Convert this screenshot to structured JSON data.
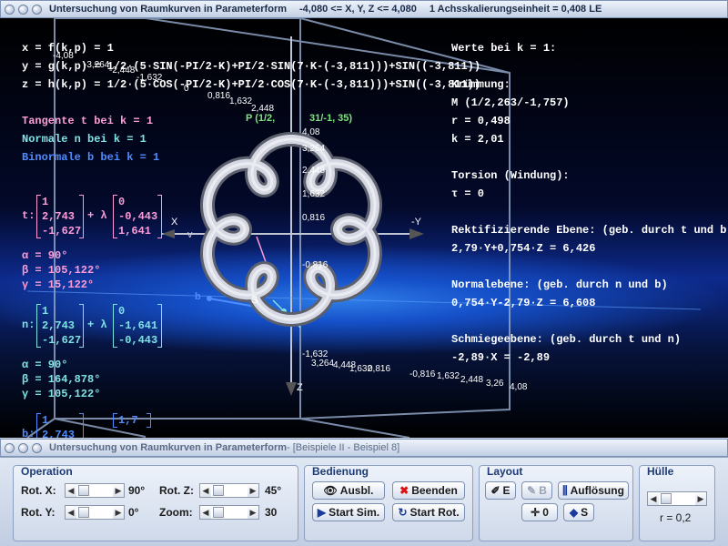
{
  "window": {
    "title": "Untersuchung von Raumkurven in Parameterform",
    "range": "-4,080 <= X, Y, Z <= 4,080",
    "unit": "1 Achsskalierungseinheit = 0,408 LE"
  },
  "window2": {
    "title": "Untersuchung von Raumkurven in Parameterform",
    "subtitle": " - [Beispiele II - Beispiel 8]"
  },
  "formulas": {
    "x": "x = f(k,p) = 1",
    "y": "y = g(k,p) = 1/2·(5·SIN(-PI/2-K)+PI/2·SIN(7·K-(-3,811)))+SIN((-3,811))",
    "z": "z = h(k,p) = 1/2·(5·COS(-PI/2-K)+PI/2·COS(7·K-(-3,811)))+SIN((-3,811))"
  },
  "legend": {
    "tangent": "Tangente t bei k = 1",
    "normal": "Normale n bei k = 1",
    "binormal": "Binormale b bei k = 1"
  },
  "vectors": {
    "t_label": "t:",
    "n_label": "n:",
    "b_label": "b:",
    "plus_lambda": "+ λ",
    "t_point": [
      "1",
      "2,743",
      "-1,627"
    ],
    "t_dir": [
      "0",
      "-0,443",
      "1,641"
    ],
    "t_angles": [
      "α = 90°",
      "β = 105,122°",
      "γ = 15,122°"
    ],
    "n_point": [
      "1",
      "2,743",
      "-1,627"
    ],
    "n_dir": [
      "0",
      "-1,641",
      "-0,443"
    ],
    "n_angles": [
      "α = 90°",
      "β = 164,878°",
      "γ = 105,122°"
    ],
    "b_point": [
      "1",
      "2,743"
    ],
    "b_dir": [
      "1,7"
    ]
  },
  "values": {
    "header": "Werte bei k = 1:",
    "curvature_label": "Krümmung:",
    "m": "M (1/2,263/-1,757)",
    "r": "r = 0,498",
    "k": "k = 2,01",
    "torsion_label": "Torsion (Windung):",
    "tau": "τ = 0",
    "rect_label": "Rektifizierende Ebene: (geb. durch t und b)",
    "rect_eq": "2,79·Y+0,754·Z = 6,426",
    "normal_label": "Normalebene: (geb. durch n und b)",
    "normal_eq": "0,754·Y-2,79·Z = 6,608",
    "osc_label": "Schmiegeebene: (geb. durch t und n)",
    "osc_eq": "-2,89·X = -2,89"
  },
  "axis": {
    "x_neg": "X",
    "y_pos": "-Y",
    "z": "Z",
    "y_ticks": [
      "-4,08",
      "-3,264",
      "-2,448",
      "-1,632",
      "0",
      "0,816",
      "1,632",
      "2,448"
    ],
    "z_ticks": [
      "4,08",
      "3,264",
      "2,448",
      "1,632",
      "0,816",
      "-0,816",
      "-1,632"
    ],
    "bottom_ticks": [
      "3,264",
      "4,448",
      "1,632",
      "0,816",
      "-0,816",
      "1,632",
      "2,448",
      "3,26",
      "4,08"
    ],
    "point_label": "P (1/2,",
    "point_label2": "31/-1,  35)",
    "b_marker": "b",
    "s_marker": "S",
    "v_marker": "v"
  },
  "operation": {
    "title": "Operation",
    "rot_x_label": "Rot. X:",
    "rot_x_value": "90°",
    "rot_y_label": "Rot. Y:",
    "rot_y_value": "0°",
    "rot_z_label": "Rot. Z:",
    "rot_z_value": "45°",
    "zoom_label": "Zoom:",
    "zoom_value": "30"
  },
  "bedienung": {
    "title": "Bedienung",
    "ausbl": "Ausbl.",
    "beenden": "Beenden",
    "start_sim": "Start Sim.",
    "start_rot": "Start Rot."
  },
  "layout": {
    "title": "Layout",
    "e": "E",
    "b": "B",
    "aufloesung": "Auflösung",
    "zero": "0",
    "s": "S"
  },
  "huelle": {
    "title": "Hülle",
    "r": "r = 0,2"
  },
  "colors": {
    "tangent": "#ff9cd8",
    "normal": "#7fe3e3",
    "binormal": "#4f8cff",
    "curve": "#c9ccd6"
  }
}
